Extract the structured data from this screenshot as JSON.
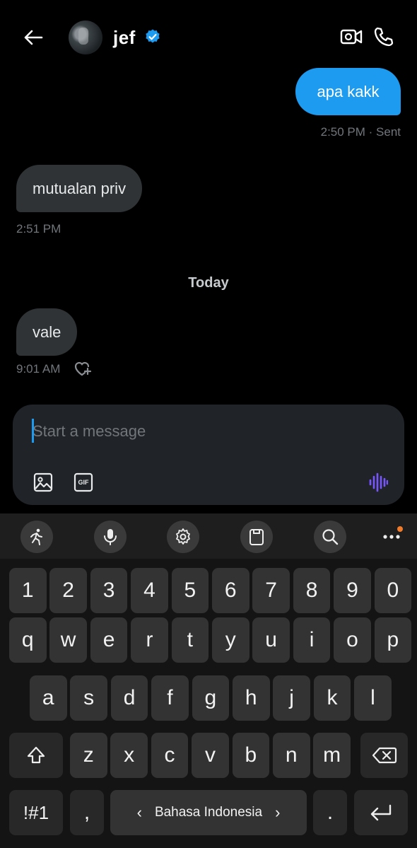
{
  "header": {
    "contact_name": "jef",
    "icons": [
      "back-arrow-icon",
      "avatar",
      "verified-badge-icon",
      "video-call-icon",
      "phone-call-icon"
    ]
  },
  "messages": [
    {
      "direction": "sent",
      "text": "apa kakk",
      "meta": "2:50 PM · Sent"
    },
    {
      "direction": "received",
      "text": "mutualan priv",
      "meta": "2:51 PM"
    },
    {
      "direction": "divider",
      "text": "Today"
    },
    {
      "direction": "received",
      "text": "vale",
      "meta": "9:01 AM"
    }
  ],
  "composer": {
    "placeholder": "Start a message",
    "gif_label": "GIF"
  },
  "keyboard": {
    "toolbar": [
      "run-mode-icon",
      "microphone-icon",
      "settings-icon",
      "clipboard-icon",
      "search-icon",
      "more-icon"
    ],
    "number_row": [
      "1",
      "2",
      "3",
      "4",
      "5",
      "6",
      "7",
      "8",
      "9",
      "0"
    ],
    "row1": [
      "q",
      "w",
      "e",
      "r",
      "t",
      "y",
      "u",
      "i",
      "o",
      "p"
    ],
    "row2": [
      "a",
      "s",
      "d",
      "f",
      "g",
      "h",
      "j",
      "k",
      "l"
    ],
    "row3": [
      "z",
      "x",
      "c",
      "v",
      "b",
      "n",
      "m"
    ],
    "symbols_key": "!#1",
    "comma_key": ",",
    "space_label": "Bahasa Indonesia",
    "period_key": "."
  },
  "colors": {
    "accent": "#1d9bf0",
    "received_bubble": "#2f3336",
    "voice_icon": "#7856ff",
    "notification_dot": "#f07b2b"
  }
}
